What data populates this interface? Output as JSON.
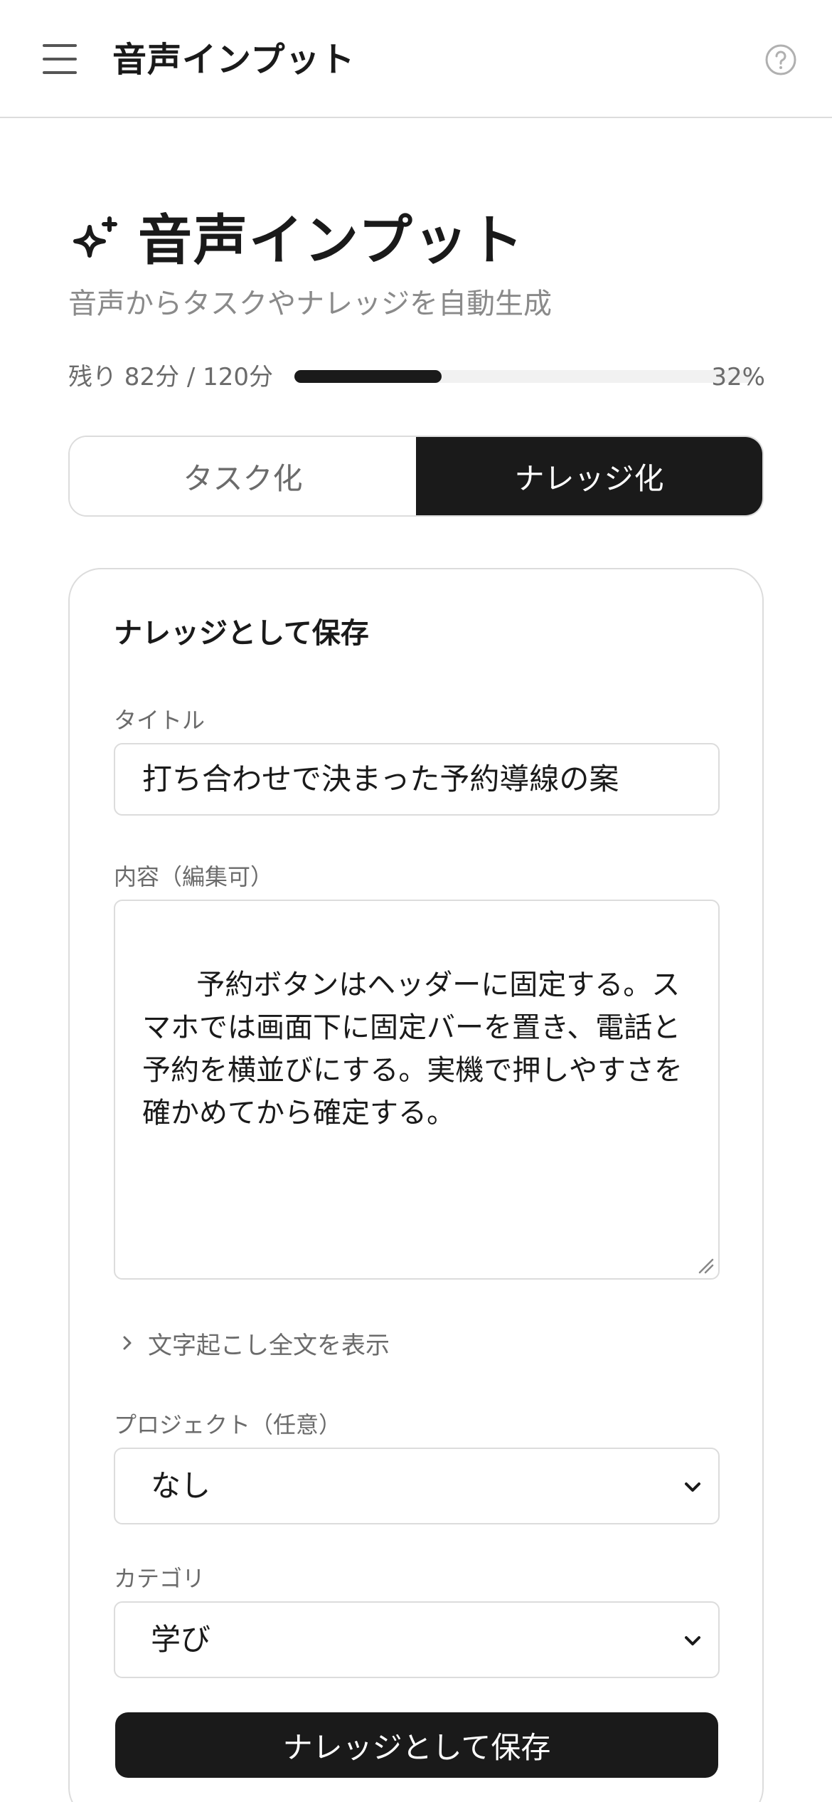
{
  "header": {
    "title": "音声インプット"
  },
  "page": {
    "title": "音声インプット",
    "subtitle": "音声からタスクやナレッジを自動生成"
  },
  "usage": {
    "text": "残り 82分 / 120分",
    "percent_label": "32%",
    "progress_fraction": 0.32
  },
  "modes": {
    "tabs": [
      {
        "label": "タスク化",
        "active": false
      },
      {
        "label": "ナレッジ化",
        "active": true
      }
    ]
  },
  "form": {
    "card_title": "ナレッジとして保存",
    "title_label": "タイトル",
    "title_value": "打ち合わせで決まった予約導線の案",
    "content_label": "内容（編集可）",
    "content_value": "予約ボタンはヘッダーに固定する。スマホでは画面下に固定バーを置き、電話と予約を横並びにする。実機で押しやすさを確かめてから確定する。",
    "transcript_toggle": "文字起こし全文を表示",
    "project_label": "プロジェクト（任意）",
    "project_value": "なし",
    "category_label": "カテゴリ",
    "category_value": "学び",
    "submit_label": "ナレッジとして保存"
  },
  "icons": {
    "menu": "hamburger-menu-icon",
    "help": "help-circle-icon",
    "title": "sparkle-icon",
    "disclosure": "chevron-right-icon",
    "select": "chevron-down-icon"
  },
  "colors": {
    "accent": "#1a1a1a",
    "muted_text": "#6b6b6b",
    "border": "#dcdcdc",
    "track": "#f1f1f1"
  }
}
